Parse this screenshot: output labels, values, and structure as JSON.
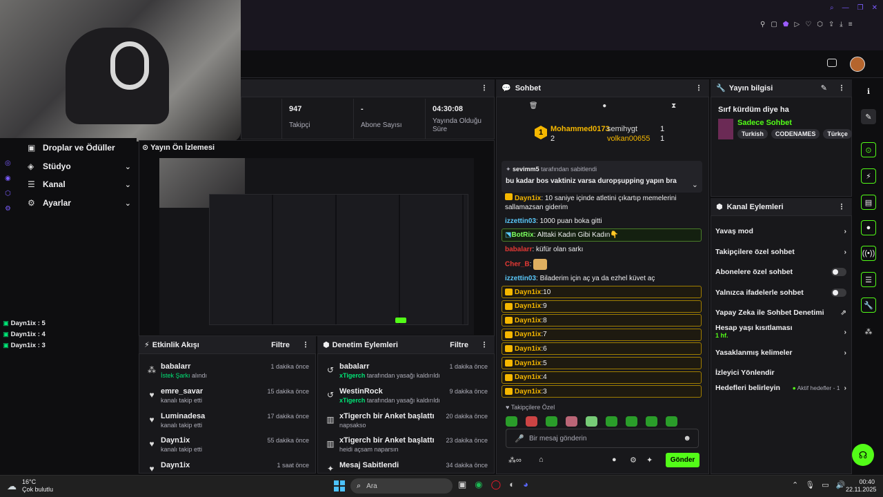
{
  "stats": [
    {
      "value": "947",
      "label": "Takipçi"
    },
    {
      "value": "-",
      "label": "Abone Sayısı"
    },
    {
      "value": "04:30:08",
      "label": "Yayında Olduğu Süre"
    }
  ],
  "nav": [
    {
      "label": "Droplar ve Ödüller",
      "icon": "gift-icon"
    },
    {
      "label": "Stüdyo",
      "icon": "studio-icon"
    },
    {
      "label": "Kanal",
      "icon": "channel-icon"
    },
    {
      "label": "Ayarlar",
      "icon": "gear-icon"
    }
  ],
  "overlay_lines": [
    "Dayn1ix : 5",
    "Dayn1ix : 4",
    "Dayn1ix : 3"
  ],
  "preview": {
    "title": "Yayın Ön İzlemesi"
  },
  "activity": {
    "title": "Etkinlik Akışı",
    "filter": "Filtre",
    "rows": [
      {
        "name": "babalarr",
        "desc_green": "İstek Şarkı",
        "desc": "alındı",
        "time": "1 dakika önce"
      },
      {
        "name": "emre_savar",
        "desc_green": "",
        "desc": "kanalı takip etti",
        "time": "15 dakika önce"
      },
      {
        "name": "Luminadesa",
        "desc_green": "",
        "desc": "kanalı takip etti",
        "time": "17 dakika önce"
      },
      {
        "name": "Dayn1ix",
        "desc_green": "",
        "desc": "kanalı takip etti",
        "time": "55 dakika önce"
      },
      {
        "name": "Dayn1ix",
        "desc_green": "",
        "desc": "",
        "time": "1 saat önce"
      }
    ]
  },
  "moderation": {
    "title": "Denetim Eylemleri",
    "filter": "Filtre",
    "rows": [
      {
        "name": "babalarr",
        "desc_green": "xTigerch",
        "desc": "tarafından yasağı kaldırıldı",
        "time": "1 dakika önce"
      },
      {
        "name": "WestinRock",
        "desc_green": "xTigerch",
        "desc": "tarafından yasağı kaldırıldı",
        "time": "9 dakika önce"
      },
      {
        "name": "xTigerch bir Anket başlattı",
        "desc_green": "",
        "desc": "napsakso",
        "time": "20 dakika önce"
      },
      {
        "name": "xTigerch bir Anket başlattı",
        "desc_green": "",
        "desc": "heidi açsam naparsın",
        "time": "23 dakika önce"
      },
      {
        "name": "Mesaj Sabitlendi",
        "desc_green": "",
        "desc": "",
        "time": "34 dakika önce"
      }
    ]
  },
  "chat": {
    "title": "Sohbet",
    "top": {
      "first": "Mohammed0173",
      "first_count": "2",
      "second": "semihygt",
      "second_count": "1",
      "third": "volkan00655",
      "third_count": "1",
      "rank": "1"
    },
    "pinned_by": "sevimm5",
    "pinned_suffix": "tarafından sabitlendi",
    "pinned_text": "bu kadar bos vaktiniz varsa duropşupping yapın bra",
    "messages": [
      {
        "user": "Dayn1ix",
        "text": ": 10 saniye içinde atletini çıkartıp memelerini sallamazsan giderim"
      },
      {
        "user": "izzettin03",
        "text": ": 1000 puan boka gitti"
      },
      {
        "user": "BotRix",
        "text": ": Alttaki Kadın Gibi Kadın👇"
      },
      {
        "user": "babalarr",
        "text": ": küfür olan sarkı"
      },
      {
        "user": "Cher_B",
        "text": ":"
      },
      {
        "user": "izzettin03",
        "text": ": Biladerim için aç ya da ezhel küvet aç"
      }
    ],
    "countdown": [
      "10",
      "9",
      "8",
      "7",
      "6",
      "5",
      "4",
      "3"
    ],
    "countdown_user": "Dayn1ix",
    "emote_label": "Takipçilere Özel",
    "input_placeholder": "Bir mesaj gönderin",
    "send": "Gönder"
  },
  "info": {
    "title": "Yayın bilgisi",
    "stream_title": "Sırf kürdüm diye ha",
    "category": "Sadece Sohbet",
    "tags": [
      "Turkish",
      "CODENAMES",
      "Türkçe"
    ]
  },
  "actions": {
    "title": "Kanal Eylemleri",
    "items": [
      {
        "label": "Yavaş mod",
        "ctrl": "chev"
      },
      {
        "label": "Takipçilere özel sohbet",
        "ctrl": "chev"
      },
      {
        "label": "Abonelere özel sohbet",
        "ctrl": "toggle"
      },
      {
        "label": "Yalnızca ifadelerle sohbet",
        "ctrl": "toggle"
      },
      {
        "label": "Yapay Zeka ile Sohbet Denetimi",
        "ctrl": "ext"
      },
      {
        "label": "Hesap yaşı kısıtlaması",
        "sub": "1 hf.",
        "ctrl": "chev"
      },
      {
        "label": "Yasaklanmış kelimeler",
        "ctrl": "chev"
      },
      {
        "label": "İzleyici Yönlendir",
        "ctrl": ""
      },
      {
        "label": "Hedefleri belirleyin",
        "extra": "Aktif hedefler - 1",
        "ctrl": "chev"
      }
    ]
  },
  "taskbar": {
    "temp": "16°C",
    "weather": "Çok bulutlu",
    "search": "Ara",
    "time": "00:40",
    "date": "22.11.2025"
  },
  "colors": {
    "accent": "#53fc18",
    "gold": "#f5b700",
    "panel": "#18181b"
  }
}
